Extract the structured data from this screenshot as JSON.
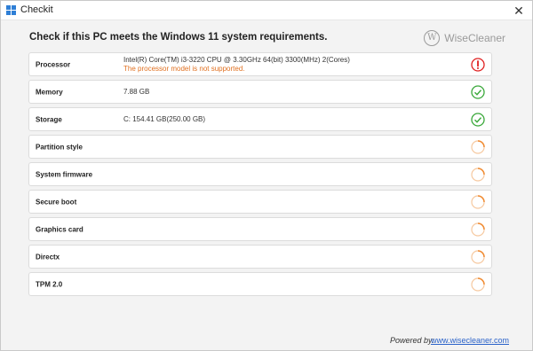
{
  "window": {
    "title": "Checkit"
  },
  "heading": "Check if this PC meets the Windows 11 system requirements.",
  "brand": {
    "logo_letter": "W",
    "name": "WiseCleaner"
  },
  "rows": [
    {
      "label": "Processor",
      "value": "Intel(R) Core(TM) i3-3220 CPU @ 3.30GHz 64(bit) 3300(MHz) 2(Cores)",
      "note": "The processor model is not supported.",
      "status": "fail"
    },
    {
      "label": "Memory",
      "value": "7.88 GB",
      "note": "",
      "status": "pass"
    },
    {
      "label": "Storage",
      "value": "C: 154.41 GB(250.00 GB)",
      "note": "",
      "status": "pass"
    },
    {
      "label": "Partition style",
      "value": "",
      "note": "",
      "status": "checking"
    },
    {
      "label": "System firmware",
      "value": "",
      "note": "",
      "status": "checking"
    },
    {
      "label": "Secure boot",
      "value": "",
      "note": "",
      "status": "checking"
    },
    {
      "label": "Graphics card",
      "value": "",
      "note": "",
      "status": "checking"
    },
    {
      "label": "Directx",
      "value": "",
      "note": "",
      "status": "checking"
    },
    {
      "label": "TPM 2.0",
      "value": "",
      "note": "",
      "status": "checking"
    }
  ],
  "footer": {
    "powered_by": "Powered by:",
    "link": "www.wisecleaner.com"
  },
  "colors": {
    "fail": "#e02020",
    "pass": "#3aa83a",
    "checking": "#f08a30",
    "link": "#2a62c9"
  }
}
